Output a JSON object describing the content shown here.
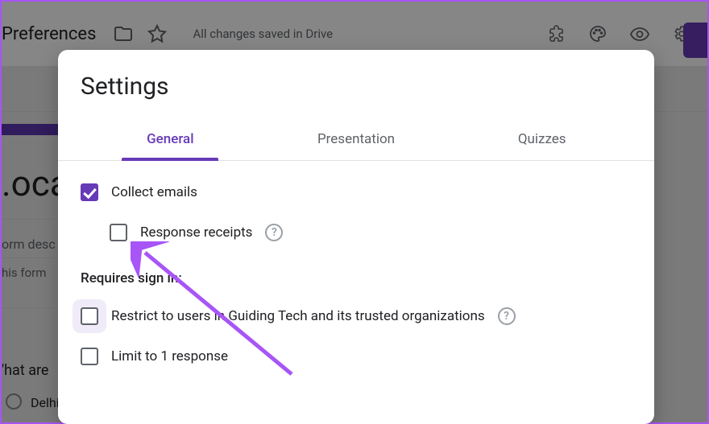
{
  "background": {
    "doc_title": "Preferences",
    "save_status": "All changes saved in Drive",
    "form_title": ".oca",
    "form_desc_placeholder": "orm desc",
    "hint": "his form",
    "question": "'hat are",
    "option1": "Delhi"
  },
  "modal": {
    "title": "Settings",
    "tabs": {
      "general": "General",
      "presentation": "Presentation",
      "quizzes": "Quizzes"
    },
    "collect_emails": "Collect emails",
    "response_receipts": "Response receipts",
    "requires_sign_in": "Requires sign in:",
    "restrict": "Restrict to users in Guiding Tech and its trusted organizations",
    "limit": "Limit to 1 response"
  }
}
